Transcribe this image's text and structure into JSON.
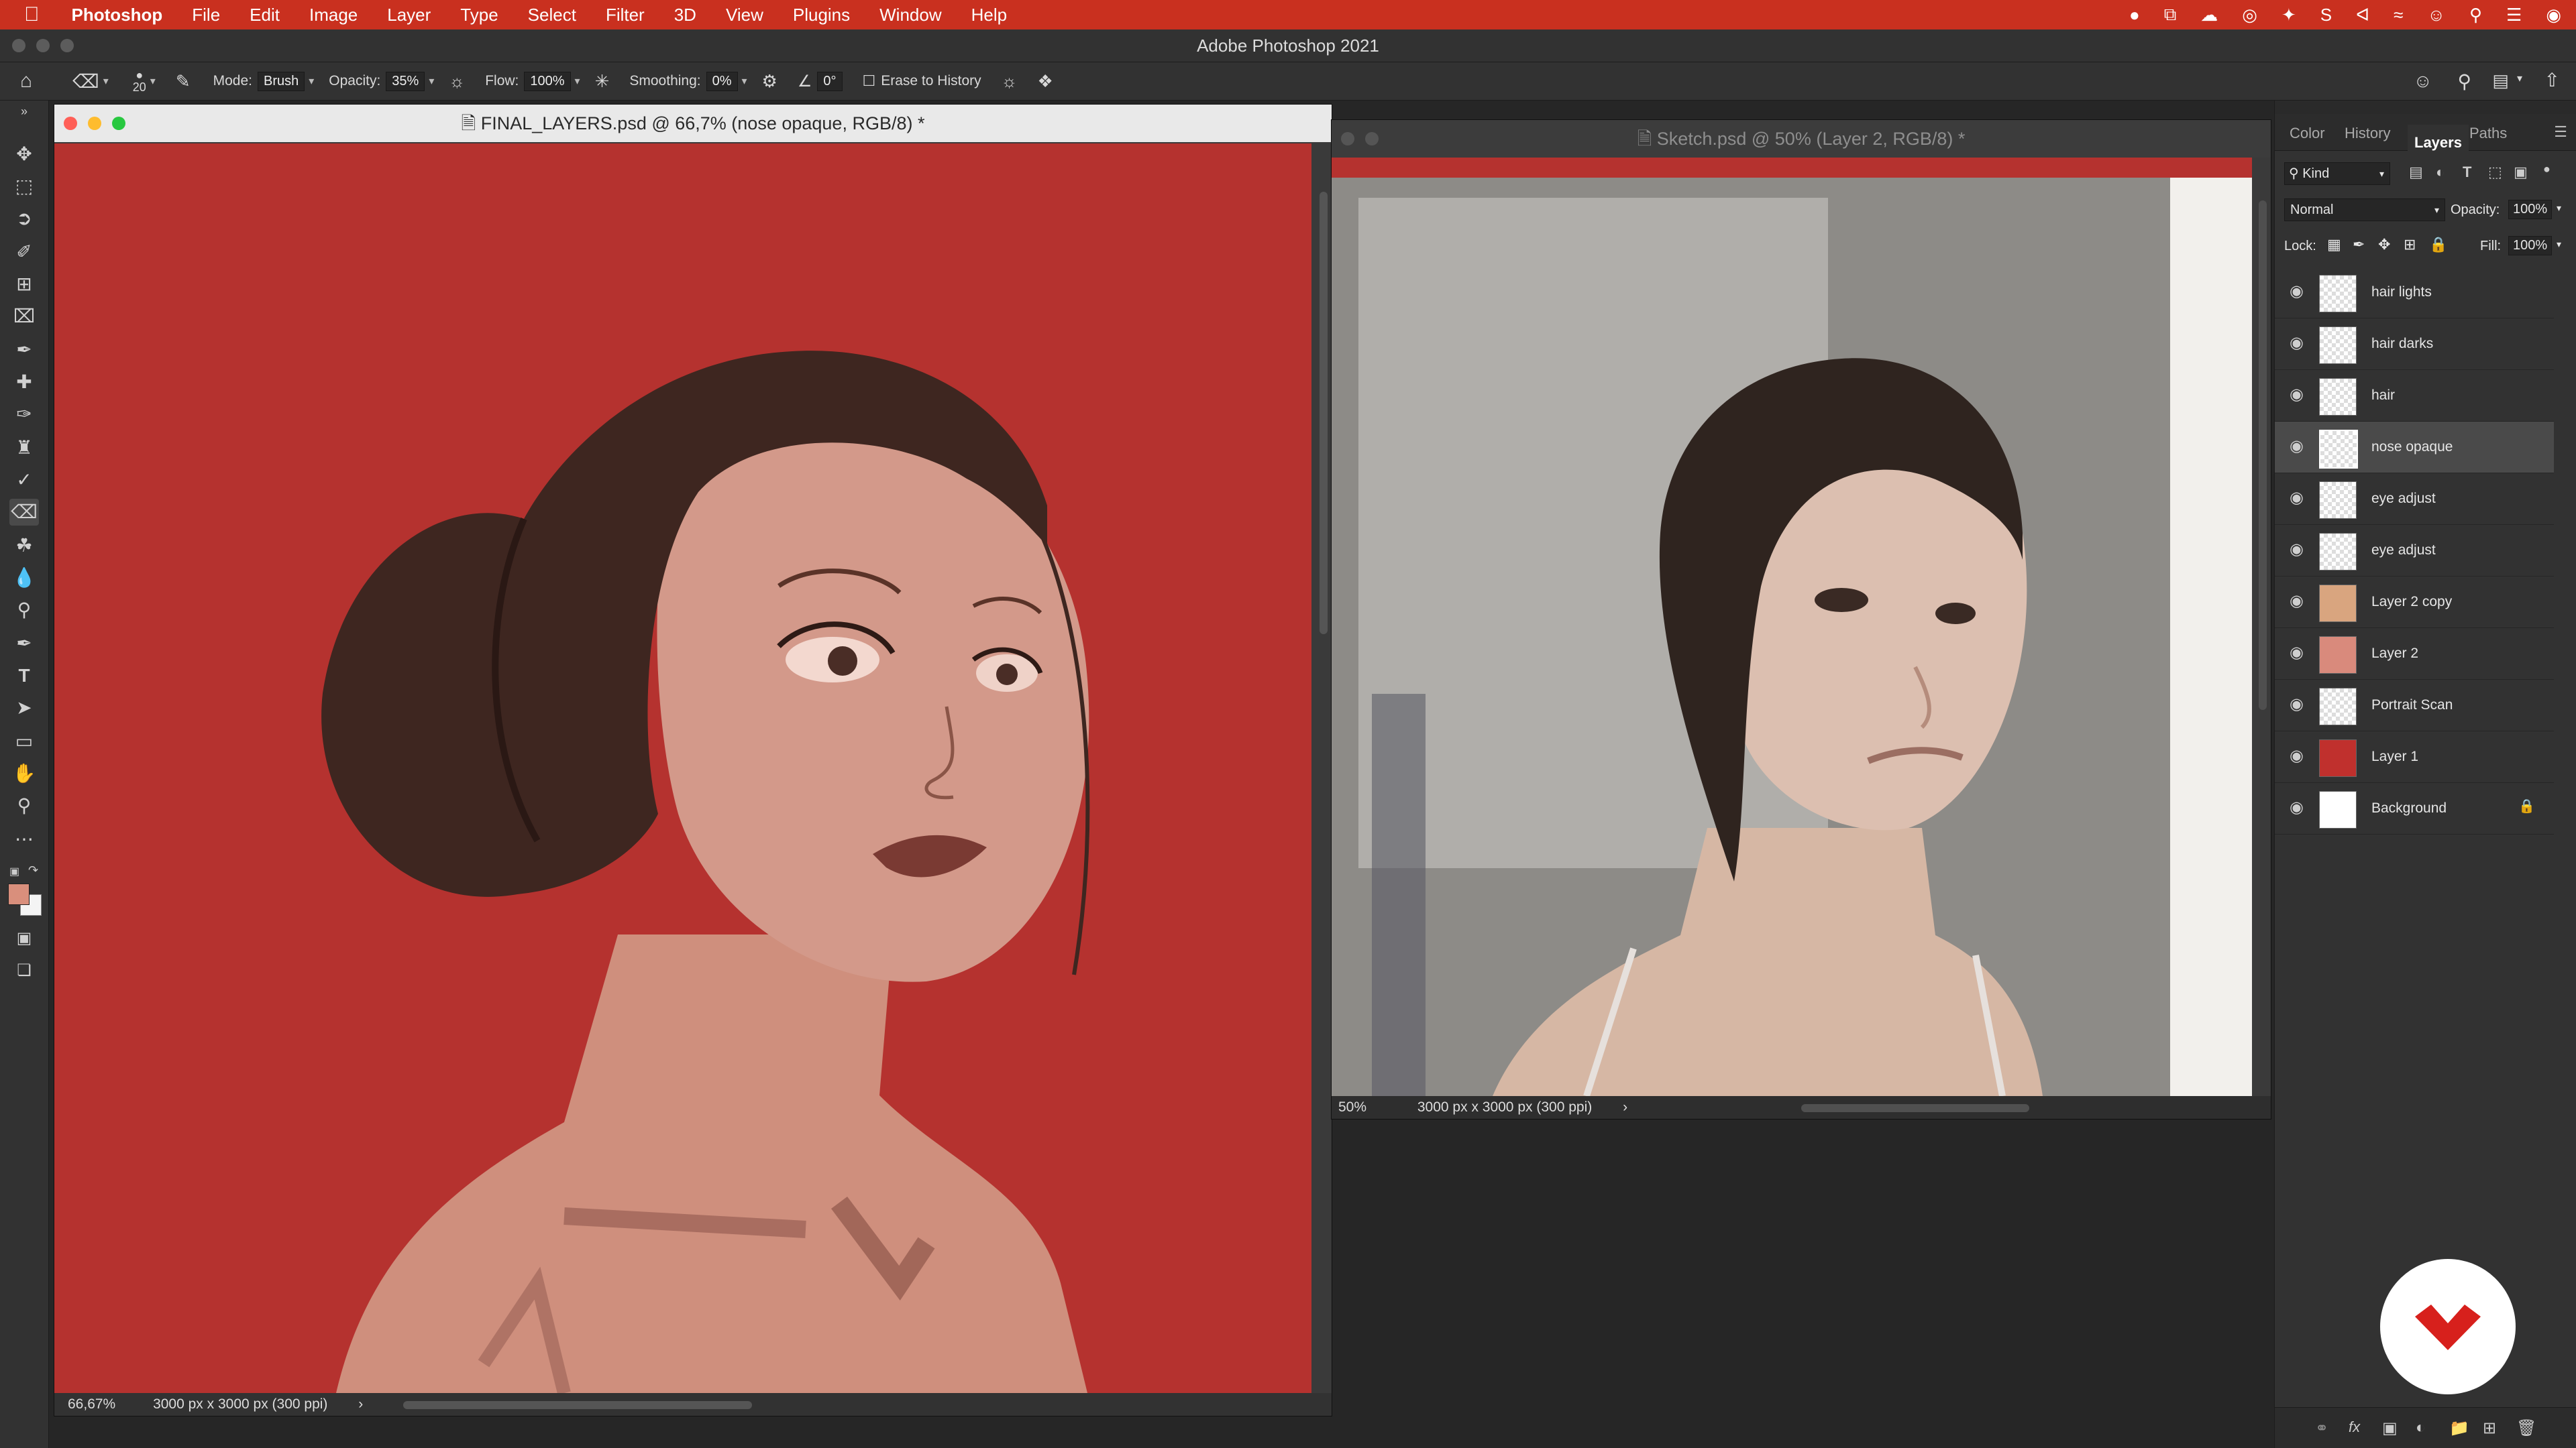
{
  "menubar": {
    "app_name": "Photoshop",
    "items": [
      "File",
      "Edit",
      "Image",
      "Layer",
      "Type",
      "Select",
      "Filter",
      "3D",
      "View",
      "Plugins",
      "Window",
      "Help"
    ]
  },
  "window": {
    "title": "Adobe Photoshop 2021"
  },
  "options": {
    "brush_size": "20",
    "mode_label": "Mode:",
    "mode_value": "Brush",
    "opacity_label": "Opacity:",
    "opacity_value": "35%",
    "flow_label": "Flow:",
    "flow_value": "100%",
    "smoothing_label": "Smoothing:",
    "smoothing_value": "0%",
    "angle_value": "0°",
    "erase_history_label": "Erase to History"
  },
  "doc1": {
    "title": "FINAL_LAYERS.psd @ 66,7% (nose opaque, RGB/8) *",
    "zoom": "66,67%",
    "size": "3000 px x 3000 px (300 ppi)",
    "canvas_color": "#b5322f"
  },
  "doc2": {
    "title": "Sketch.psd @ 50% (Layer 2, RGB/8) *",
    "zoom": "50%",
    "size": "3000 px x 3000 px (300 ppi)"
  },
  "panel": {
    "tabs": [
      "Color",
      "History",
      "Layers",
      "Paths"
    ],
    "active_tab": "Layers",
    "kind_label": "Kind",
    "blend_mode": "Normal",
    "opacity_label": "Opacity:",
    "opacity_value": "100%",
    "lock_label": "Lock:",
    "fill_label": "Fill:",
    "fill_value": "100%",
    "layers": [
      {
        "name": "hair lights",
        "thumb": "checker"
      },
      {
        "name": "hair darks",
        "thumb": "checker"
      },
      {
        "name": "hair",
        "thumb": "checker"
      },
      {
        "name": "nose opaque",
        "thumb": "checker",
        "selected": true
      },
      {
        "name": "eye adjust",
        "thumb": "checker"
      },
      {
        "name": "eye adjust",
        "thumb": "checker"
      },
      {
        "name": "Layer 2 copy",
        "thumb": "#d9a57f"
      },
      {
        "name": "Layer 2",
        "thumb": "#d98a7c"
      },
      {
        "name": "Portrait Scan",
        "thumb": "checker"
      },
      {
        "name": "Layer 1",
        "thumb": "#c0302d"
      },
      {
        "name": "Background",
        "thumb": "#ffffff",
        "locked": true
      }
    ]
  },
  "colors": {
    "accent_red": "#c9301f",
    "skin": "#d99a85",
    "hair": "#3e2620"
  }
}
